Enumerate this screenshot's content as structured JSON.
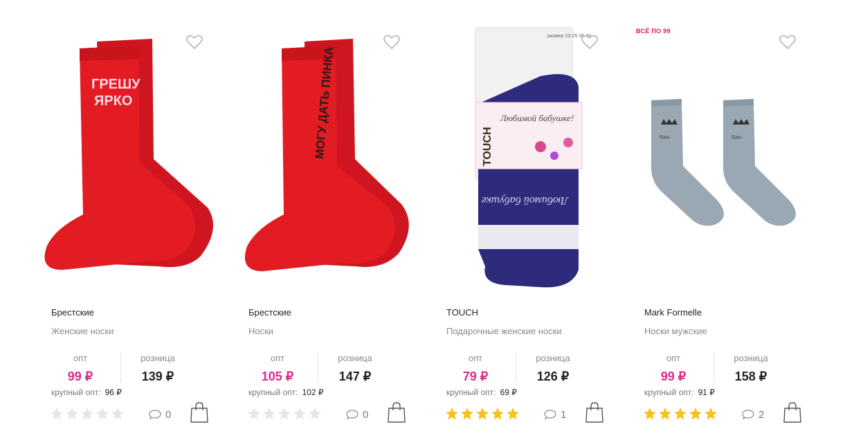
{
  "currency": "₽",
  "labels": {
    "opt": "опт",
    "retail": "розница",
    "bulk": "крупный опт:"
  },
  "colors": {
    "accent_price": "#e0298b",
    "star_on": "#f7c21b",
    "star_off": "#e6e6e6",
    "promo": "#e5173f"
  },
  "products": [
    {
      "brand": "Брестские",
      "title": "Женские носки",
      "promo": "",
      "opt_price": "99 ₽",
      "retail_price": "139 ₽",
      "bulk_price": "96 ₽",
      "rating": 0,
      "comments": "0",
      "sock_color": "#e31b22",
      "sock_text": "ГРЕШУ ЯРКО"
    },
    {
      "brand": "Брестские",
      "title": "Носки",
      "promo": "",
      "opt_price": "105 ₽",
      "retail_price": "147 ₽",
      "bulk_price": "102 ₽",
      "rating": 0,
      "comments": "0",
      "sock_color": "#e31b22",
      "sock_text": "МОГУ ДАТЬ ПИНКА"
    },
    {
      "brand": "TOUCH",
      "title": "Подарочные женские носки",
      "promo": "",
      "opt_price": "79 ₽",
      "retail_price": "126 ₽",
      "bulk_price": "69 ₽",
      "rating": 5,
      "comments": "1",
      "sock_color": "#2e2a7c",
      "sock_text": "Любимой бабушке",
      "label_brand": "TOUCH",
      "label_text": "Любимой бабушке!",
      "label_sizes": "размер 23-25 36-40"
    },
    {
      "brand": "Mark Formelle",
      "title": "Носки мужские",
      "promo": "ВСЁ ПО 99",
      "opt_price": "99 ₽",
      "retail_price": "158 ₽",
      "bulk_price": "91 ₽",
      "rating": 5,
      "comments": "2",
      "sock_color": "#9aa8b3",
      "sock_text": "Царь просто Царь"
    }
  ]
}
